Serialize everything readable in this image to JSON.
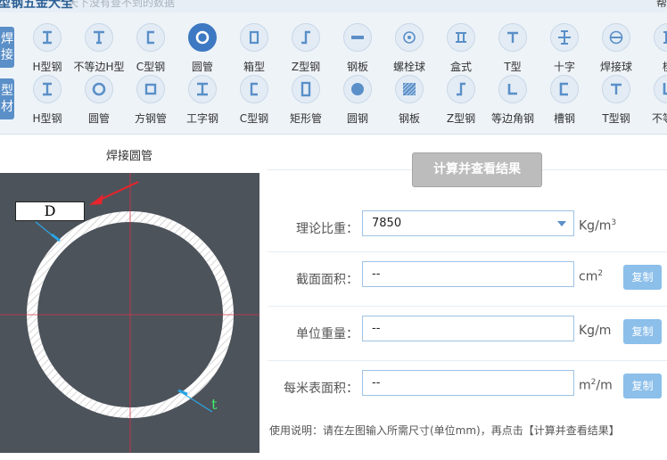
{
  "header": {
    "brand": "型钢五金大全",
    "slogan": "天下没有查不到的数据",
    "right_text": "帮"
  },
  "categories": [
    {
      "label_top": "焊",
      "label_bottom": "接"
    },
    {
      "label_top": "型",
      "label_bottom": "材"
    }
  ],
  "toolbar_row1": [
    {
      "label": "H型钢",
      "icon": "h-beam-icon"
    },
    {
      "label": "不等边H型",
      "icon": "unequal-h-beam-icon"
    },
    {
      "label": "C型钢",
      "icon": "c-channel-icon"
    },
    {
      "label": "圆管",
      "icon": "round-tube-icon"
    },
    {
      "label": "箱型",
      "icon": "box-section-icon"
    },
    {
      "label": "Z型钢",
      "icon": "z-section-icon"
    },
    {
      "label": "钢板",
      "icon": "steel-plate-icon"
    },
    {
      "label": "螺栓球",
      "icon": "bolt-ball-icon"
    },
    {
      "label": "盒式",
      "icon": "box-type-icon"
    },
    {
      "label": "T型",
      "icon": "t-section-icon"
    },
    {
      "label": "十字",
      "icon": "cross-section-icon"
    },
    {
      "label": "焊接球",
      "icon": "welded-ball-icon"
    },
    {
      "label": "楔",
      "icon": "wedge-icon"
    }
  ],
  "toolbar_row2": [
    {
      "label": "H型钢",
      "icon": "h-beam-icon"
    },
    {
      "label": "圆管",
      "icon": "round-tube-icon"
    },
    {
      "label": "方钢管",
      "icon": "square-tube-icon"
    },
    {
      "label": "工字钢",
      "icon": "i-beam-icon"
    },
    {
      "label": "C型钢",
      "icon": "c-channel-icon"
    },
    {
      "label": "矩形管",
      "icon": "rect-tube-icon"
    },
    {
      "label": "圆钢",
      "icon": "round-bar-icon"
    },
    {
      "label": "钢板",
      "icon": "steel-plate-icon"
    },
    {
      "label": "Z型钢",
      "icon": "z-section-icon"
    },
    {
      "label": "等边角钢",
      "icon": "equal-angle-icon"
    },
    {
      "label": "槽钢",
      "icon": "channel-icon"
    },
    {
      "label": "T型钢",
      "icon": "t-section-icon"
    },
    {
      "label": "不等边",
      "icon": "unequal-angle-icon"
    }
  ],
  "selected_item": "圆管",
  "diagram": {
    "title": "焊接圆管",
    "dim_d": "D",
    "dim_t": "t"
  },
  "calculate_button": "计算并查看结果",
  "fields": {
    "density": {
      "label": "理论比重：",
      "value": "7850",
      "unit_base": "Kg/m",
      "unit_sup": "3"
    },
    "area": {
      "label": "截面面积：",
      "value": "--",
      "unit_base": "cm",
      "unit_sup": "2",
      "copy": "复制"
    },
    "weight": {
      "label": "单位重量：",
      "value": "--",
      "unit_base": "Kg/m",
      "unit_sup": "",
      "copy": "复制"
    },
    "surface": {
      "label": "每米表面积：",
      "value": "--",
      "unit_base": "m",
      "unit_sup": "2",
      "unit_after": "/m",
      "copy": "复制"
    }
  },
  "usage": "使用说明：请在左图输入所需尺寸(单位mm)，再点击【计算并查看结果】",
  "colors": {
    "accent": "#3d78c3",
    "copy_button": "#8cbfea",
    "diagram_bg": "#4d535b",
    "calc_button": "#bcbcbc"
  }
}
